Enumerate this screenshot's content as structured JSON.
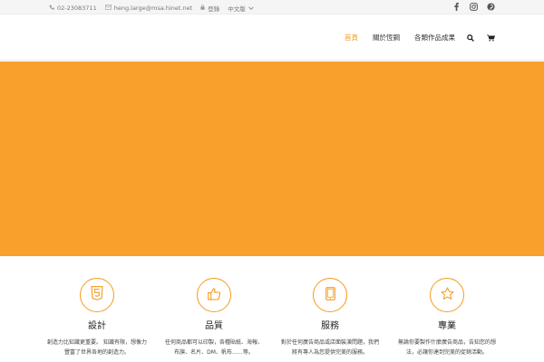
{
  "topbar": {
    "phone": "02-23083711",
    "email": "heng.large@msa.hinet.net",
    "login": "登錄",
    "language": "中文版"
  },
  "nav": {
    "items": [
      "首頁",
      "關於恆鋼",
      "各類作品成果"
    ]
  },
  "features": [
    {
      "title": "設計",
      "text": "創造力比知識更重要。 知識有限，想像力豐富了世界各地的創造力。",
      "icon": "html5-icon"
    },
    {
      "title": "品質",
      "text": "任何商品都可以印製，各種貼紙、海報、布旗、名片、DM、帆布……等。",
      "icon": "thumbs-up-icon"
    },
    {
      "title": "服務",
      "text": "對於任何廣告商品或店面裝潢問題，我們將有專人為您提供完美的服務。",
      "icon": "tablet-icon"
    },
    {
      "title": "專業",
      "text": "無論你要製作什麼廣告商品，告知您的想法，必讓你達到完美的促銷活動。",
      "icon": "star-icon"
    }
  ],
  "colors": {
    "accent": "#f39c1f",
    "hero": "#f89f2c"
  }
}
